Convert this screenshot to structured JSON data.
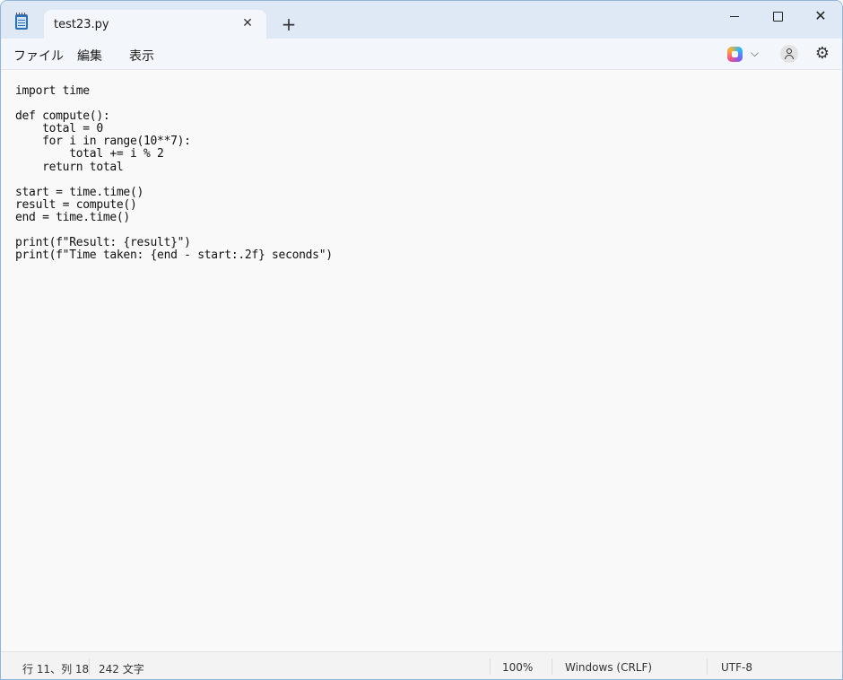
{
  "titlebar": {
    "tab_title": "test23.py",
    "close_tab_glyph": "✕",
    "new_tab_glyph": "+",
    "app_icon": "notepad-icon",
    "minimize_icon": "minimize-icon",
    "maximize_icon": "maximize-icon",
    "close_glyph": "✕"
  },
  "menu": {
    "file": "ファイル",
    "edit": "編集",
    "view": "表示",
    "copilot_icon": "copilot-icon",
    "chevron_glyph": "⌵",
    "account_icon": "account-icon",
    "settings_glyph": "⚙"
  },
  "editor": {
    "lines": [
      "import time",
      "",
      "def compute():",
      "    total = 0",
      "    for i in range(10**7):",
      "        total += i % 2",
      "    return total",
      "",
      "start = time.time()",
      "result = compute()",
      "end = time.time()",
      "",
      "print(f\"Result: {result}\")",
      "print(f\"Time taken: {end - start:.2f} seconds\")"
    ]
  },
  "status": {
    "position": "行 11、列 18",
    "chars": "242 文字",
    "zoom": "100%",
    "line_ending": "Windows (CRLF)",
    "encoding": "UTF-8"
  },
  "colors": {
    "titlebar_bg": "#dfe9f5",
    "editor_bg": "#f9f9f9",
    "accent": "#2f6fb5"
  }
}
